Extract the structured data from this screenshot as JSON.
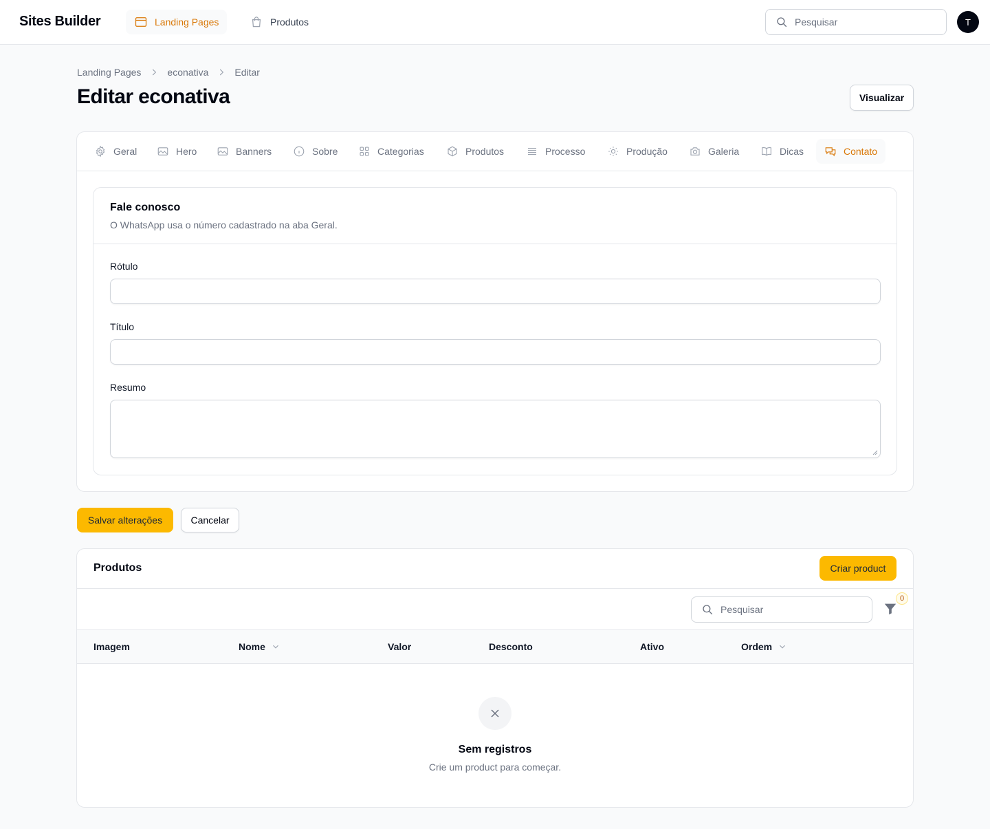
{
  "app": {
    "brand": "Sites Builder",
    "user_initial": "T"
  },
  "topnav": [
    {
      "label": "Landing Pages",
      "icon": "browser-window-icon",
      "active": true
    },
    {
      "label": "Produtos",
      "icon": "shopping-bag-icon",
      "active": false
    }
  ],
  "global_search": {
    "placeholder": "Pesquisar"
  },
  "breadcrumb": [
    "Landing Pages",
    "econativa",
    "Editar"
  ],
  "page": {
    "title": "Editar econativa",
    "view_button": "Visualizar"
  },
  "tabs": [
    {
      "label": "Geral",
      "icon": "gear-icon"
    },
    {
      "label": "Hero",
      "icon": "photo-icon"
    },
    {
      "label": "Banners",
      "icon": "photo-icon"
    },
    {
      "label": "Sobre",
      "icon": "info-circle-icon"
    },
    {
      "label": "Categorias",
      "icon": "squares-grid-icon"
    },
    {
      "label": "Produtos",
      "icon": "cube-icon"
    },
    {
      "label": "Processo",
      "icon": "queue-list-icon"
    },
    {
      "label": "Produção",
      "icon": "sun-icon"
    },
    {
      "label": "Galeria",
      "icon": "camera-icon"
    },
    {
      "label": "Dicas",
      "icon": "book-open-icon"
    },
    {
      "label": "Contato",
      "icon": "chat-bubbles-icon",
      "active": true
    }
  ],
  "section": {
    "title": "Fale conosco",
    "description": "O WhatsApp usa o número cadastrado na aba Geral.",
    "fields": [
      {
        "label": "Rótulo",
        "value": ""
      },
      {
        "label": "Título",
        "value": ""
      },
      {
        "label": "Resumo",
        "value": ""
      }
    ]
  },
  "actions": {
    "save": "Salvar alterações",
    "cancel": "Cancelar"
  },
  "products": {
    "title": "Produtos",
    "create_button": "Criar product",
    "search_placeholder": "Pesquisar",
    "filter_count": "0",
    "columns": [
      "Imagem",
      "Nome",
      "Valor",
      "Desconto",
      "Ativo",
      "Ordem"
    ],
    "empty_title": "Sem registros",
    "empty_description": "Crie um product para começar."
  },
  "colors": {
    "accent": "#d97706",
    "primary_button": "#fcb900"
  }
}
